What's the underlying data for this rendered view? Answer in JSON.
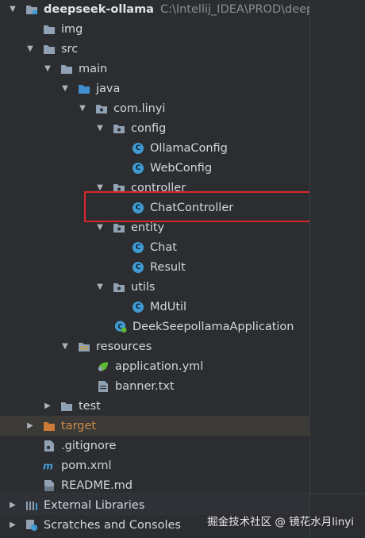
{
  "project": {
    "name": "deepseek-ollama",
    "path": "C:\\Intellij_IDEA\\PROD\\deep"
  },
  "tree": {
    "img": "img",
    "src": "src",
    "main": "main",
    "java": "java",
    "package": "com.linyi",
    "config": "config",
    "ollama_config": "OllamaConfig",
    "web_config": "WebConfig",
    "controller": "controller",
    "chat_controller": "ChatController",
    "entity": "entity",
    "chat": "Chat",
    "result": "Result",
    "utils": "utils",
    "md_util": "MdUtil",
    "application_class": "DeekSeepollamaApplication",
    "resources": "resources",
    "application_yml": "application.yml",
    "banner_txt": "banner.txt",
    "test": "test",
    "target": "target",
    "gitignore": ".gitignore",
    "pom": "pom.xml",
    "readme": "README.md",
    "external_libraries": "External Libraries",
    "scratches": "Scratches and Consoles"
  },
  "watermark": "掘金技术社区 @ 镜花水月linyi",
  "colors": {
    "background": "#2b2d30",
    "class_icon": "#3f9bd1",
    "target_folder": "#cf8a4a",
    "highlight_box": "#d8262c"
  }
}
